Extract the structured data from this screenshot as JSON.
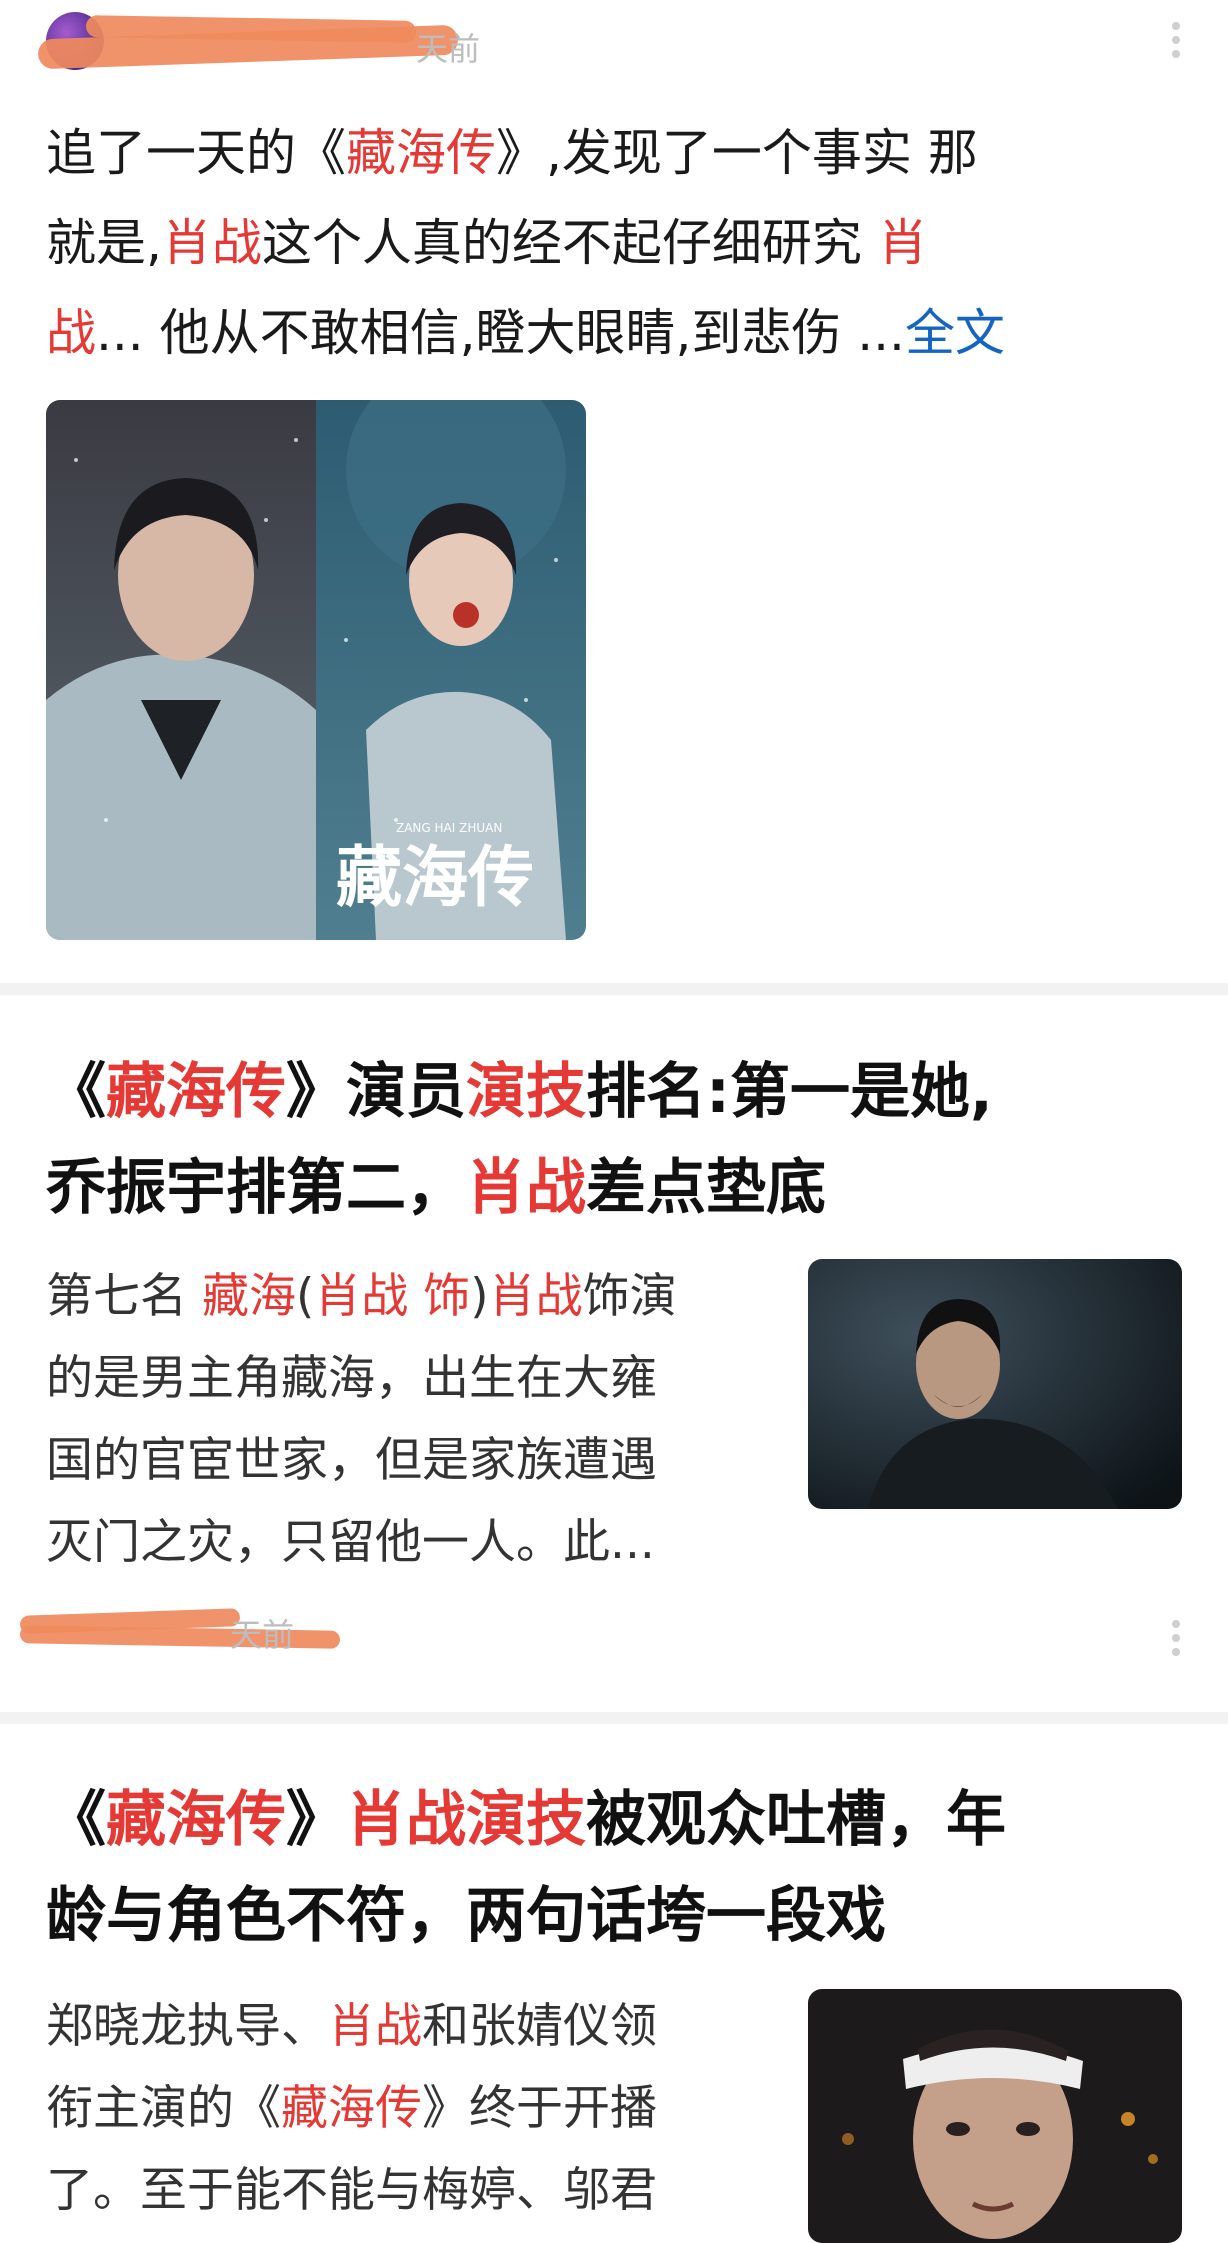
{
  "card1": {
    "author_time": "天前",
    "text_lines": [
      [
        {
          "t": "追了一天的《"
        },
        {
          "t": "藏海传",
          "hl": true
        },
        {
          "t": "》,发现了一个事实 那"
        }
      ],
      [
        {
          "t": "就是,"
        },
        {
          "t": "肖战",
          "hl": true
        },
        {
          "t": "这个人真的经不起仔细研究 "
        },
        {
          "t": "肖",
          "hl": true
        }
      ],
      [
        {
          "t": "战",
          "hl": true
        },
        {
          "t": "... 他从不敢相信,瞪大眼睛,到悲伤  ..."
        },
        {
          "t": "全文",
          "link": true
        }
      ]
    ],
    "image_alt": "藏海传",
    "image_title_text": "藏海传",
    "image_subtitle": "ZANG HAI ZHUAN"
  },
  "card2": {
    "title_lines": [
      [
        {
          "t": "《"
        },
        {
          "t": "藏海传",
          "hl": true
        },
        {
          "t": "》演员"
        },
        {
          "t": "演技",
          "hl": true
        },
        {
          "t": "排名:第一是她,"
        }
      ],
      [
        {
          "t": "乔振宇排第二，"
        },
        {
          "t": "肖战",
          "hl": true
        },
        {
          "t": "差点垫底"
        }
      ]
    ],
    "snippet_lines": [
      [
        {
          "t": "第七名 "
        },
        {
          "t": "藏海",
          "hl": true
        },
        {
          "t": "("
        },
        {
          "t": "肖战 饰",
          "hl": true
        },
        {
          "t": ")"
        },
        {
          "t": "肖战",
          "hl": true
        },
        {
          "t": "饰演"
        }
      ],
      [
        {
          "t": "的是男主角藏海，出生在大雍"
        }
      ],
      [
        {
          "t": "国的官宦世家，但是家族遭遇"
        }
      ],
      [
        {
          "t": "灭门之灾，只留他一人。此..."
        }
      ]
    ],
    "meta_time": "天前"
  },
  "card3": {
    "title_lines": [
      [
        {
          "t": "《"
        },
        {
          "t": "藏海传",
          "hl": true
        },
        {
          "t": "》"
        },
        {
          "t": "肖战演技",
          "hl": true
        },
        {
          "t": "被观众吐槽，年"
        }
      ],
      [
        {
          "t": "龄与角色不符，两句话垮一段戏"
        }
      ]
    ],
    "snippet_lines": [
      [
        {
          "t": "郑晓龙执导、"
        },
        {
          "t": "肖战",
          "hl": true
        },
        {
          "t": "和张婧仪领"
        }
      ],
      [
        {
          "t": "衔主演的《"
        },
        {
          "t": "藏海传",
          "hl": true
        },
        {
          "t": "》终于开播"
        }
      ],
      [
        {
          "t": "了。至于能不能与梅婷、邬君"
        }
      ]
    ]
  },
  "colors": {
    "highlight": "#e53935",
    "link": "#1565c0",
    "scribble": "#f08a5d",
    "separator": "#f2f2f2"
  },
  "icons": {
    "more": "more-vertical-icon"
  }
}
